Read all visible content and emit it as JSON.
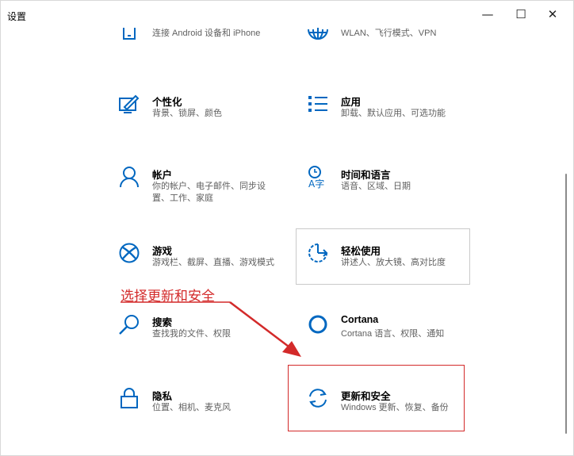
{
  "window": {
    "title": "设置",
    "minimize_glyph": "—",
    "maximize_glyph": "☐",
    "close_glyph": "✕"
  },
  "tiles": [
    {
      "name": "",
      "desc": "连接 Android 设备和 iPhone",
      "icon": "phone-icon"
    },
    {
      "name": "",
      "desc": "WLAN、飞行模式、VPN",
      "icon": "globe-icon"
    },
    {
      "name": "个性化",
      "desc": "背景、锁屏、颜色",
      "icon": "personalization-icon"
    },
    {
      "name": "应用",
      "desc": "卸载、默认应用、可选功能",
      "icon": "apps-list-icon"
    },
    {
      "name": "帐户",
      "desc": "你的帐户、电子邮件、同步设置、工作、家庭",
      "icon": "person-icon"
    },
    {
      "name": "时间和语言",
      "desc": "语音、区域、日期",
      "icon": "time-language-icon"
    },
    {
      "name": "游戏",
      "desc": "游戏栏、截屏、直播、游戏模式",
      "icon": "xbox-icon"
    },
    {
      "name": "轻松使用",
      "desc": "讲述人、放大镜、高对比度",
      "icon": "ease-of-access-icon"
    },
    {
      "name": "搜索",
      "desc": "查找我的文件、权限",
      "icon": "search-icon"
    },
    {
      "name": "Cortana",
      "desc": "Cortana 语言、权限、通知",
      "icon": "cortana-icon"
    },
    {
      "name": "隐私",
      "desc": "位置、相机、麦克风",
      "icon": "lock-icon"
    },
    {
      "name": "更新和安全",
      "desc": "Windows 更新、恢复、备份",
      "icon": "update-sync-icon"
    }
  ],
  "annotation": {
    "text": "选择更新和安全",
    "color": "#d32a2a"
  },
  "colors": {
    "accent": "#0067c0",
    "annotation_red": "#d32a2a"
  }
}
